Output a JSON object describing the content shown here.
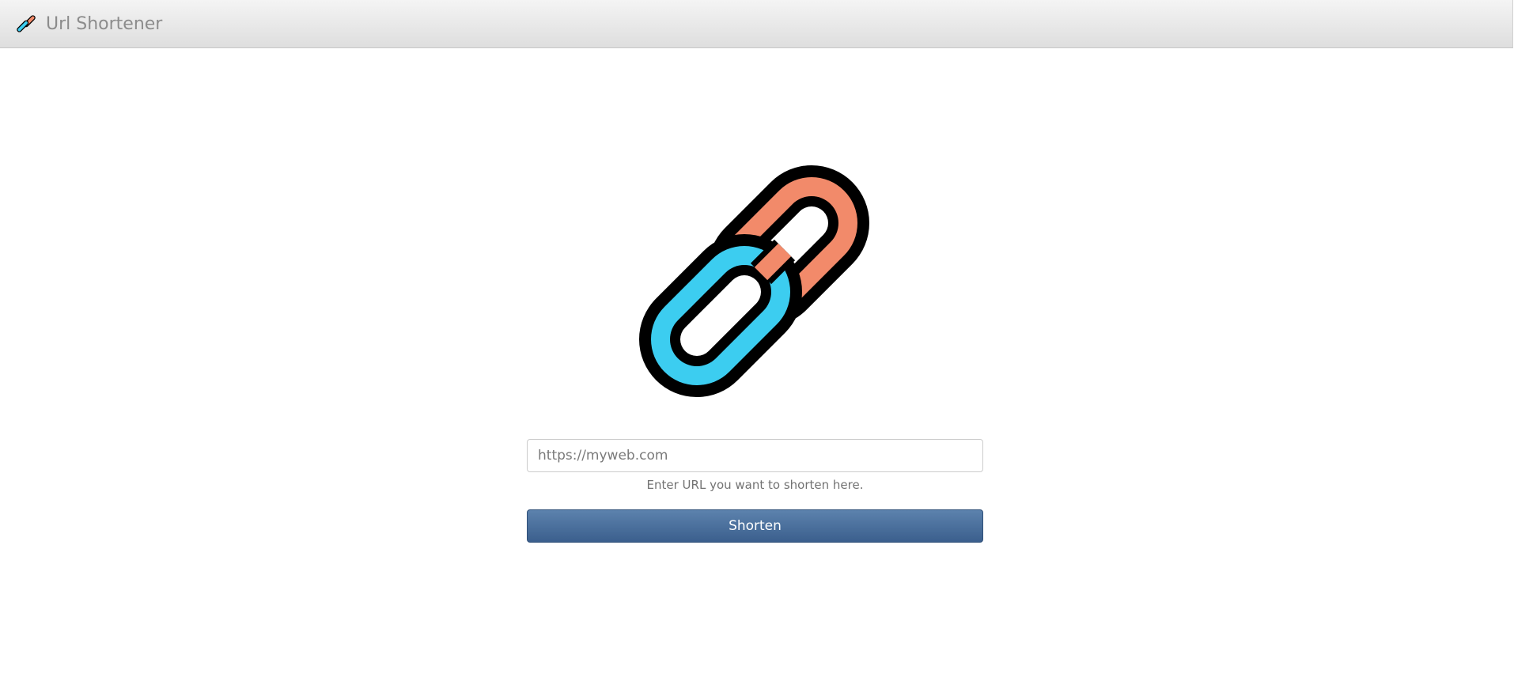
{
  "app": {
    "brand": "Url Shortener",
    "logo_icon": "chain-link-icon"
  },
  "form": {
    "url_placeholder": "https://myweb.com",
    "url_value": "",
    "help_text": "Enter URL you want to shorten here.",
    "submit_label": "Shorten"
  },
  "colors": {
    "link_orange": "#F28A6A",
    "link_blue": "#3CCDF0",
    "outline": "#000000",
    "button_blue": "#4A6F9C"
  }
}
